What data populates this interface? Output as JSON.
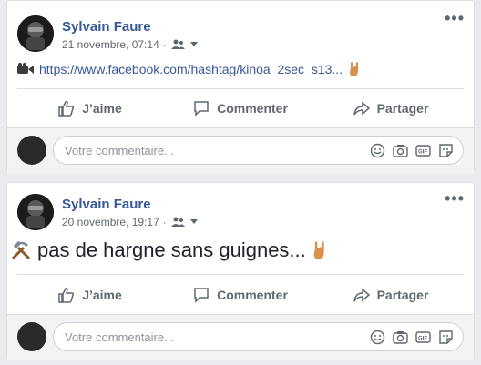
{
  "posts": [
    {
      "author": "Sylvain Faure",
      "date": "21 novembre, 07:14",
      "text_link": "https://www.facebook.com/hashtag/kinoa_2sec_s13...",
      "actions": {
        "like": "J’aime",
        "comment": "Commenter",
        "share": "Partager"
      },
      "comment_placeholder": "Votre commentaire..."
    },
    {
      "author": "Sylvain Faure",
      "date": "20 novembre, 19:17",
      "text": "pas de hargne sans guignes...",
      "actions": {
        "like": "J’aime",
        "comment": "Commenter",
        "share": "Partager"
      },
      "comment_placeholder": "Votre commentaire..."
    }
  ],
  "icons": {
    "more": "more-icon",
    "audience": "audience-icon",
    "camera": "video-camera-icon",
    "like": "thumbs-up-icon",
    "comment": "comment-icon",
    "share": "share-icon",
    "emoji": "emoji-icon",
    "photo": "camera-icon",
    "gif": "gif-icon",
    "sticker": "sticker-icon",
    "hand": "rock-hand-icon",
    "pick": "hammer-pick-icon"
  }
}
